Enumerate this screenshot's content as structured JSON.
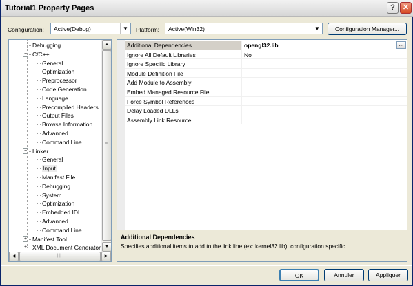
{
  "window": {
    "title": "Tutorial1 Property Pages",
    "help_glyph": "?",
    "close_glyph": "✕"
  },
  "config_bar": {
    "configuration_label": "Configuration:",
    "configuration_value": "Active(Debug)",
    "platform_label": "Platform:",
    "platform_value": "Active(Win32)",
    "manager_button": "Configuration Manager..."
  },
  "tree": {
    "items": [
      {
        "label": "Debugging"
      },
      {
        "label": "C/C++",
        "expander": "−"
      },
      {
        "label": "General"
      },
      {
        "label": "Optimization"
      },
      {
        "label": "Preprocessor"
      },
      {
        "label": "Code Generation"
      },
      {
        "label": "Language"
      },
      {
        "label": "Precompiled Headers"
      },
      {
        "label": "Output Files"
      },
      {
        "label": "Browse Information"
      },
      {
        "label": "Advanced"
      },
      {
        "label": "Command Line"
      },
      {
        "label": "Linker",
        "expander": "−"
      },
      {
        "label": "General"
      },
      {
        "label": "Input",
        "selected": true
      },
      {
        "label": "Manifest File"
      },
      {
        "label": "Debugging"
      },
      {
        "label": "System"
      },
      {
        "label": "Optimization"
      },
      {
        "label": "Embedded IDL"
      },
      {
        "label": "Advanced"
      },
      {
        "label": "Command Line"
      },
      {
        "label": "Manifest Tool",
        "expander": "+"
      },
      {
        "label": "XML Document Generator",
        "expander": "+"
      }
    ],
    "scroll_up_glyph": "▲",
    "scroll_down_glyph": "▼",
    "scroll_left_glyph": "◀",
    "scroll_right_glyph": "▶",
    "thumb_grip": "≡",
    "hthumb_grip": "|||"
  },
  "properties": {
    "rows": [
      {
        "name": "Additional Dependencies",
        "value": "opengl32.lib",
        "bold": true,
        "selected": true
      },
      {
        "name": "Ignore All Default Libraries",
        "value": "No"
      },
      {
        "name": "Ignore Specific Library",
        "value": ""
      },
      {
        "name": "Module Definition File",
        "value": ""
      },
      {
        "name": "Add Module to Assembly",
        "value": ""
      },
      {
        "name": "Embed Managed Resource File",
        "value": ""
      },
      {
        "name": "Force Symbol References",
        "value": ""
      },
      {
        "name": "Delay Loaded DLLs",
        "value": ""
      },
      {
        "name": "Assembly Link Resource",
        "value": ""
      }
    ],
    "ellipsis_label": "..."
  },
  "description": {
    "title": "Additional Dependencies",
    "text": "Specifies additional items to add to the link line (ex: kernel32.lib); configuration specific."
  },
  "buttons": {
    "ok": "OK",
    "cancel": "Annuler",
    "apply": "Appliquer"
  }
}
